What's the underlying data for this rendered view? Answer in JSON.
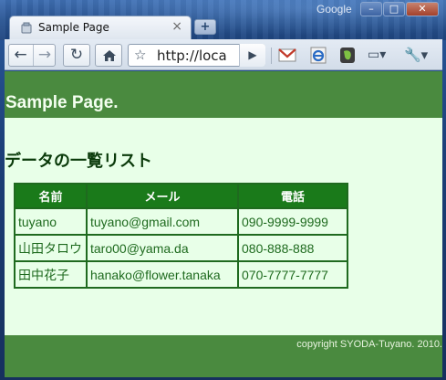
{
  "window": {
    "brand": "Google",
    "controls": {
      "minimize": "–",
      "maximize": "□",
      "close": "✕"
    }
  },
  "tab": {
    "title": "Sample Page",
    "close": "×",
    "new_tab": "+"
  },
  "toolbar": {
    "back": "←",
    "forward": "→",
    "reload": "↻",
    "star": "☆",
    "url": "http://loca",
    "go": "▶",
    "page_menu": "▭▾",
    "wrench_menu": "🔧▾"
  },
  "page": {
    "title": "Sample Page.",
    "heading": "データの一覧リスト",
    "table": {
      "headers": [
        "名前",
        "メール",
        "電話"
      ],
      "rows": [
        [
          "tuyano",
          "tuyano@gmail.com",
          "090-9999-9999"
        ],
        [
          "山田タロウ",
          "taro00@yama.da",
          "080-888-888"
        ],
        [
          "田中花子",
          "hanako@flower.tanaka",
          "070-7777-7777"
        ]
      ]
    },
    "footer": "copyright SYODA-Tuyano. 2010."
  },
  "colors": {
    "page_bg": "#e8ffe8",
    "header_bg": "#4a8a3f",
    "table_header_bg": "#1a7a1a",
    "table_text": "#1e6a1e"
  }
}
